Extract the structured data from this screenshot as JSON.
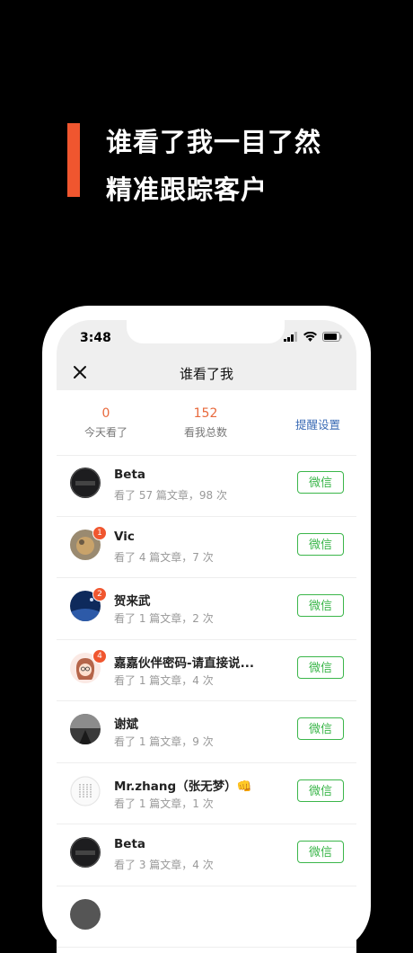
{
  "promo": {
    "line1": "谁看了我一目了然",
    "line2": "精准跟踪客户"
  },
  "status": {
    "time": "3:48"
  },
  "nav": {
    "title": "谁看了我"
  },
  "stats": {
    "today_value": "0",
    "today_label": "今天看了",
    "total_value": "152",
    "total_label": "看我总数",
    "remind_label": "提醒设置"
  },
  "contacts": [
    {
      "name": "Beta",
      "meta": "看了 57 篇文章，98 次",
      "button": "微信",
      "badge": ""
    },
    {
      "name": "Vic",
      "meta": "看了 4 篇文章，7 次",
      "button": "微信",
      "badge": "1"
    },
    {
      "name": "贺来武",
      "meta": "看了 1 篇文章，2 次",
      "button": "微信",
      "badge": "2"
    },
    {
      "name": "嘉嘉伙伴密码-请直接说...",
      "meta": "看了 1 篇文章，4 次",
      "button": "微信",
      "badge": "4"
    },
    {
      "name": "谢斌",
      "meta": "看了 1 篇文章，9 次",
      "button": "微信",
      "badge": ""
    },
    {
      "name": "Mr.zhang（张无梦）👊",
      "meta": "看了 1 篇文章，1 次",
      "button": "微信",
      "badge": ""
    },
    {
      "name": "Beta",
      "meta": "看了 3 篇文章，4 次",
      "button": "微信",
      "badge": ""
    }
  ],
  "colors": {
    "accent": "#F0562F",
    "stat_number": "#E8693C",
    "link": "#3A6BB5",
    "wechat_green": "#3BB64A"
  }
}
